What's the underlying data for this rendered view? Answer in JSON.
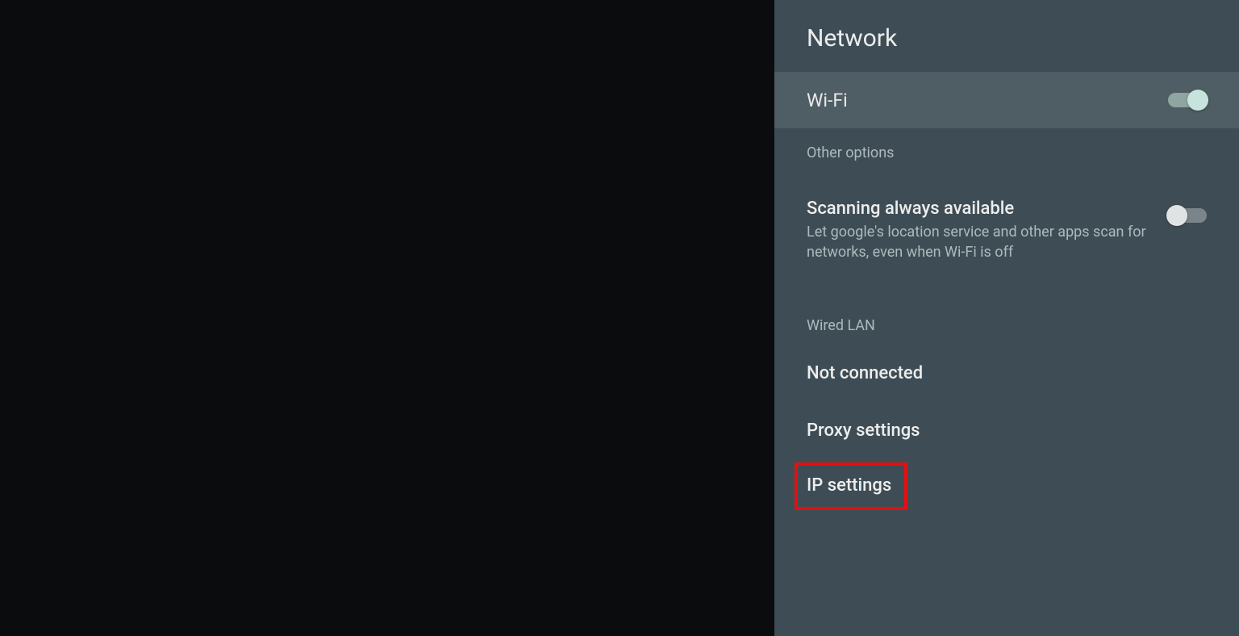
{
  "header": {
    "title": "Network"
  },
  "wifi": {
    "label": "Wi-Fi",
    "enabled": true
  },
  "sections": {
    "other_options": "Other options",
    "wired_lan": "Wired LAN"
  },
  "scanning": {
    "title": "Scanning always available",
    "description": "Let google's location service and other apps scan for networks, even when Wi-Fi is off",
    "enabled": false
  },
  "items": {
    "not_connected": "Not connected",
    "proxy_settings": "Proxy settings",
    "ip_settings": "IP settings"
  },
  "colors": {
    "panel_bg": "#3e4d55",
    "highlight_bg": "#4f5d64",
    "text_primary": "#ededed",
    "text_secondary": "#aeb9bd",
    "highlight_border": "#e80e0e"
  }
}
